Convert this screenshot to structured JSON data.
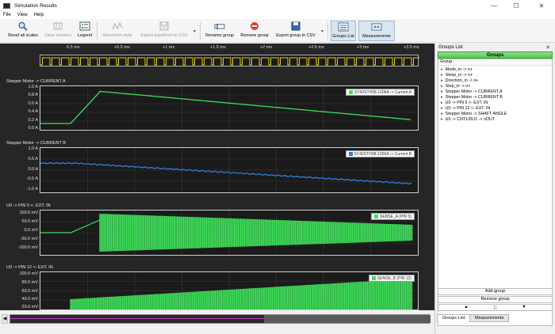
{
  "window": {
    "title": "Simulation Results",
    "controls": {
      "minimize": "—",
      "maximize": "☐",
      "close": "✕"
    }
  },
  "menu": [
    "File",
    "View",
    "Help"
  ],
  "toolbar": {
    "reset": "Reset all scales",
    "clear_markers": "Clear markers",
    "legend": "Legend",
    "waveform_style": "Waveform style",
    "export_waveform": "Export waveform to CSV",
    "rename_group": "Rename group",
    "remove_group": "Remove group",
    "export_group": "Export group to CSV",
    "groups_list": "Groups List",
    "measurements": "Measurements"
  },
  "ruler": [
    "6.5 ms",
    "+0.5 ms",
    "+1 ms",
    "+1.5 ms",
    "+2 ms",
    "+2.5 ms",
    "+3 ms",
    "+3.5 ms"
  ],
  "panels": [
    {
      "title": "Stepper Motor -> CURRENT A",
      "ticks": [
        "1.0 A",
        "0.8 A",
        "0.6 A",
        "0.4 A",
        "0.2 A",
        "0.0 A"
      ],
      "legend": "SY42STH38-1206A -> Current A",
      "color": "#3ee05a"
    },
    {
      "title": "Stepper Motor -> CURRENT B",
      "ticks": [
        "1.0 A",
        "0.5 A",
        "0.0 A",
        "-0.5 A",
        "-1.0 A"
      ],
      "legend": "SY42STH38-1206A -> Current B",
      "color": "#2f7fe0"
    },
    {
      "title": "U0 -> PIN 5 <- EXT. IN",
      "ticks": [
        "100.0 mV",
        "50.0 mV",
        "0.0 mV",
        "-50.0 mV",
        "-100.0 mV"
      ],
      "legend": "SENSE_A (PIN 5)",
      "color": "#3ee05a"
    },
    {
      "title": "U0 -> PIN 12 <- EXT. IN",
      "ticks": [
        "100.0 mV",
        "80.0 mV",
        "60.0 mV",
        "40.0 mV",
        "20.0 mV"
      ],
      "legend": "SENSE_B (PIN 12)",
      "color": "#3ee05a"
    }
  ],
  "right_panel": {
    "title": "Groups List",
    "close": "✕",
    "header": "Groups",
    "column": "Group",
    "groups": [
      "Mode_in -> n+",
      "Sleep_in -> n+",
      "Direction_in -> n+",
      "Step_in -> n+",
      "Stepper Motor -> CURRENT A",
      "Stepper Motor -> CURRENT B",
      "U0 -> PIN 5 <- EXT. IN",
      "U0 -> PIN 12 <- EXT. IN",
      "Stepper Motor -> SHAFT ANGLE",
      "U0 -> CNT1/DU1 -> nOUT"
    ],
    "add_group": "Add group",
    "remove_group": "Remove group",
    "up": "▲",
    "down": "▼",
    "tabs": [
      "Groups List",
      "Measurements"
    ]
  }
}
